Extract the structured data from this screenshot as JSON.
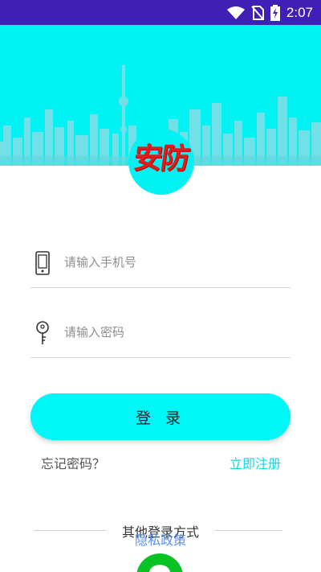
{
  "status_bar": {
    "time": "2:07",
    "icons": [
      "wifi-icon",
      "no-sim-icon",
      "battery-charging-icon"
    ]
  },
  "app": {
    "logo_text": "安防",
    "colors": {
      "accent": "#00F2F2",
      "status_bar": "#3F1FB5",
      "logo_text": "#E01B1B",
      "register_link": "#12D8E0",
      "privacy_link": "#5A8FE8",
      "wechat": "#09C223"
    }
  },
  "form": {
    "phone_placeholder": "请输入手机号",
    "phone_value": "",
    "password_placeholder": "请输入密码",
    "password_value": "",
    "login_label": "登 录",
    "forgot_password": "忘记密码？",
    "register": "立即注册"
  },
  "footer": {
    "other_login": "其他登录方式",
    "privacy_policy": "隐私政策",
    "wechat_icon": "wechat-icon"
  }
}
